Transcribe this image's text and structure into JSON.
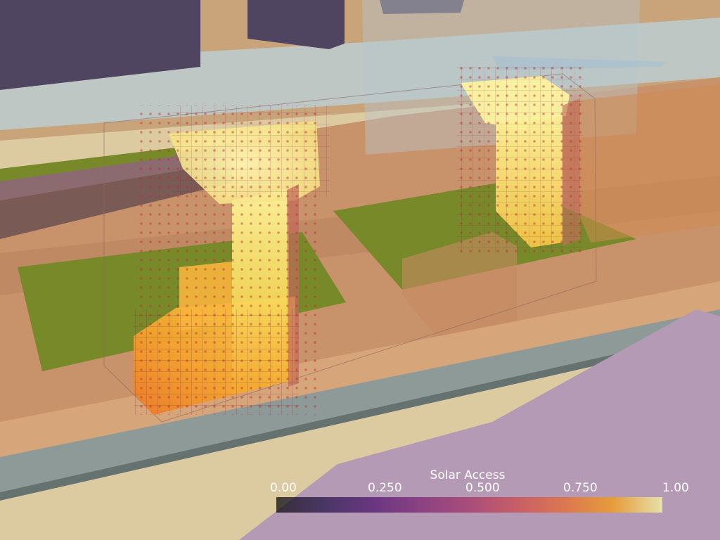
{
  "scene": {
    "description_name": "solar-access-3d-view",
    "colors": {
      "ground": "#dccaa0",
      "plaza": "#b49ab4",
      "road": "#8e9a98",
      "lawn": "#78892a",
      "building_outline": "#7a2a30",
      "voxel_point": "#c0302a",
      "glass": "#b8d0dc",
      "dark_block": "#4f4560"
    }
  },
  "legend": {
    "title": "Solar Access",
    "ticks": [
      "0.00",
      "0.250",
      "0.500",
      "0.750",
      "1.00"
    ],
    "colormap": "inferno",
    "range": [
      0,
      1
    ]
  }
}
